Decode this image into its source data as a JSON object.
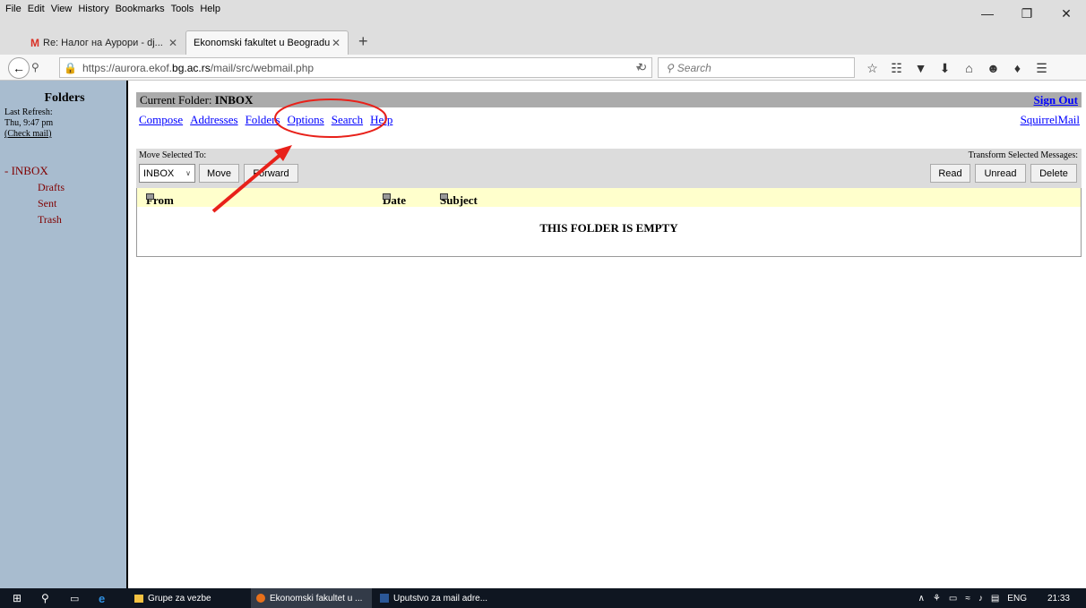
{
  "browser": {
    "menu": [
      "File",
      "Edit",
      "View",
      "History",
      "Bookmarks",
      "Tools",
      "Help"
    ],
    "tabs": [
      {
        "label": "Re: Налог на Аурори - dj..."
      },
      {
        "label": "Ekonomski fakultet u Beogradu"
      }
    ],
    "url_prefix": "https://aurora.ekof.",
    "url_domain": "bg.ac.rs",
    "url_path": "/mail/src/webmail.php",
    "search_placeholder": "Search"
  },
  "sidebar": {
    "title": "Folders",
    "last_refresh_label": "Last Refresh:",
    "last_refresh_time": "Thu, 9:47 pm",
    "check_mail": "(Check mail)",
    "inbox": "- INBOX",
    "folders": [
      "Drafts",
      "Sent",
      "Trash"
    ]
  },
  "main": {
    "current_folder_label": "Current Folder:",
    "current_folder": "INBOX",
    "sign_out": "Sign Out",
    "links": [
      "Compose",
      "Addresses",
      "Folders",
      "Options",
      "Search",
      "Help"
    ],
    "squirrelmail": "SquirrelMail",
    "move_selected_label": "Move Selected To:",
    "transform_label": "Transform Selected Messages:",
    "folder_select": "INBOX",
    "move_button": "Move",
    "forward_button": "Forward",
    "read_button": "Read",
    "unread_button": "Unread",
    "delete_button": "Delete",
    "col_from": "From",
    "col_date": "Date",
    "col_subject": "Subject",
    "empty_message": "THIS FOLDER IS EMPTY"
  },
  "annotation": {
    "color": "#e8211a"
  },
  "taskbar": {
    "apps": [
      "Grupe za vezbe",
      "Ekonomski fakultet u ...",
      "Uputstvo za mail adre..."
    ],
    "lang": "ENG",
    "time": "21:33"
  }
}
